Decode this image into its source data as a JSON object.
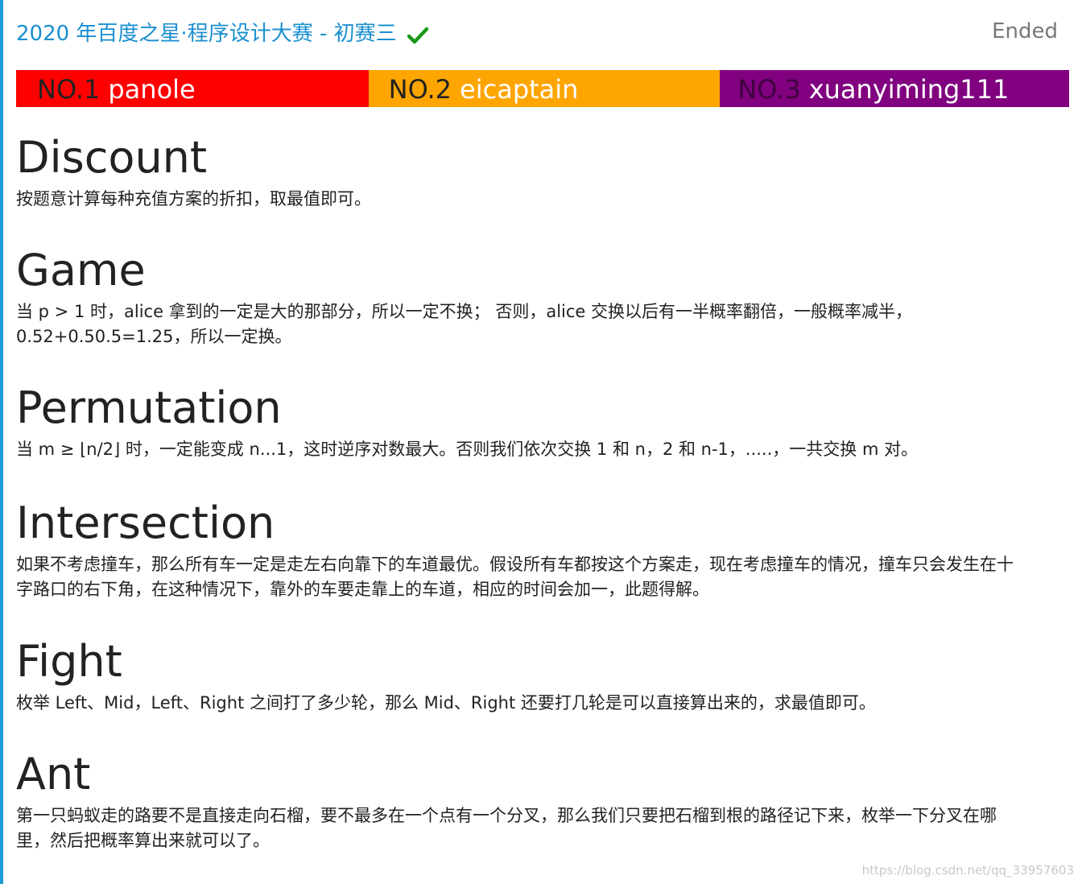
{
  "contest": {
    "title": "2020 年百度之星·程序设计大赛 - 初赛三",
    "status": "Ended",
    "accent_color": "#1a8fd0",
    "check_color": "#1a9a1a"
  },
  "winners": [
    {
      "rank": "NO.1",
      "name": "panole",
      "color": "#ff0000"
    },
    {
      "rank": "NO.2",
      "name": "eicaptain",
      "color": "#ffa500"
    },
    {
      "rank": "NO.3",
      "name": "xuanyiming111",
      "color": "#800080"
    }
  ],
  "problems": [
    {
      "title": "Discount",
      "lines": [
        "按题意计算每种充值方案的折扣，取最值即可。"
      ]
    },
    {
      "title": "Game",
      "lines": [
        "当 p > 1 时，alice 拿到的一定是大的那部分，所以一定不换； 否则，alice 交换以后有一半概率翻倍，一般概率减半，",
        "0.52+0.50.5=1.25，所以一定换。"
      ]
    },
    {
      "title": "Permutation",
      "lines": [
        "当 m ≥ ⌊n/2⌋ 时，一定能变成 n...1，这时逆序对数最大。否则我们依次交换 1 和 n，2 和 n-1，.....，一共交换 m 对。"
      ]
    },
    {
      "title": "Intersection",
      "lines": [
        "如果不考虑撞车，那么所有车一定是走左右向靠下的车道最优。假设所有车都按这个方案走，现在考虑撞车的情况，撞车只会发生在十",
        "字路口的右下角，在这种情况下，靠外的车要走靠上的车道，相应的时间会加一，此题得解。"
      ]
    },
    {
      "title": "Fight",
      "lines": [
        "枚举 Left、Mid，Left、Right 之间打了多少轮，那么 Mid、Right 还要打几轮是可以直接算出来的，求最值即可。"
      ]
    },
    {
      "title": "Ant",
      "lines": [
        "第一只蚂蚁走的路要不是直接走向石榴，要不最多在一个点有一个分叉，那么我们只要把石榴到根的路径记下来，枚举一下分叉在哪",
        "里，然后把概率算出来就可以了。"
      ]
    }
  ],
  "watermark": "https://blog.csdn.net/qq_33957603"
}
